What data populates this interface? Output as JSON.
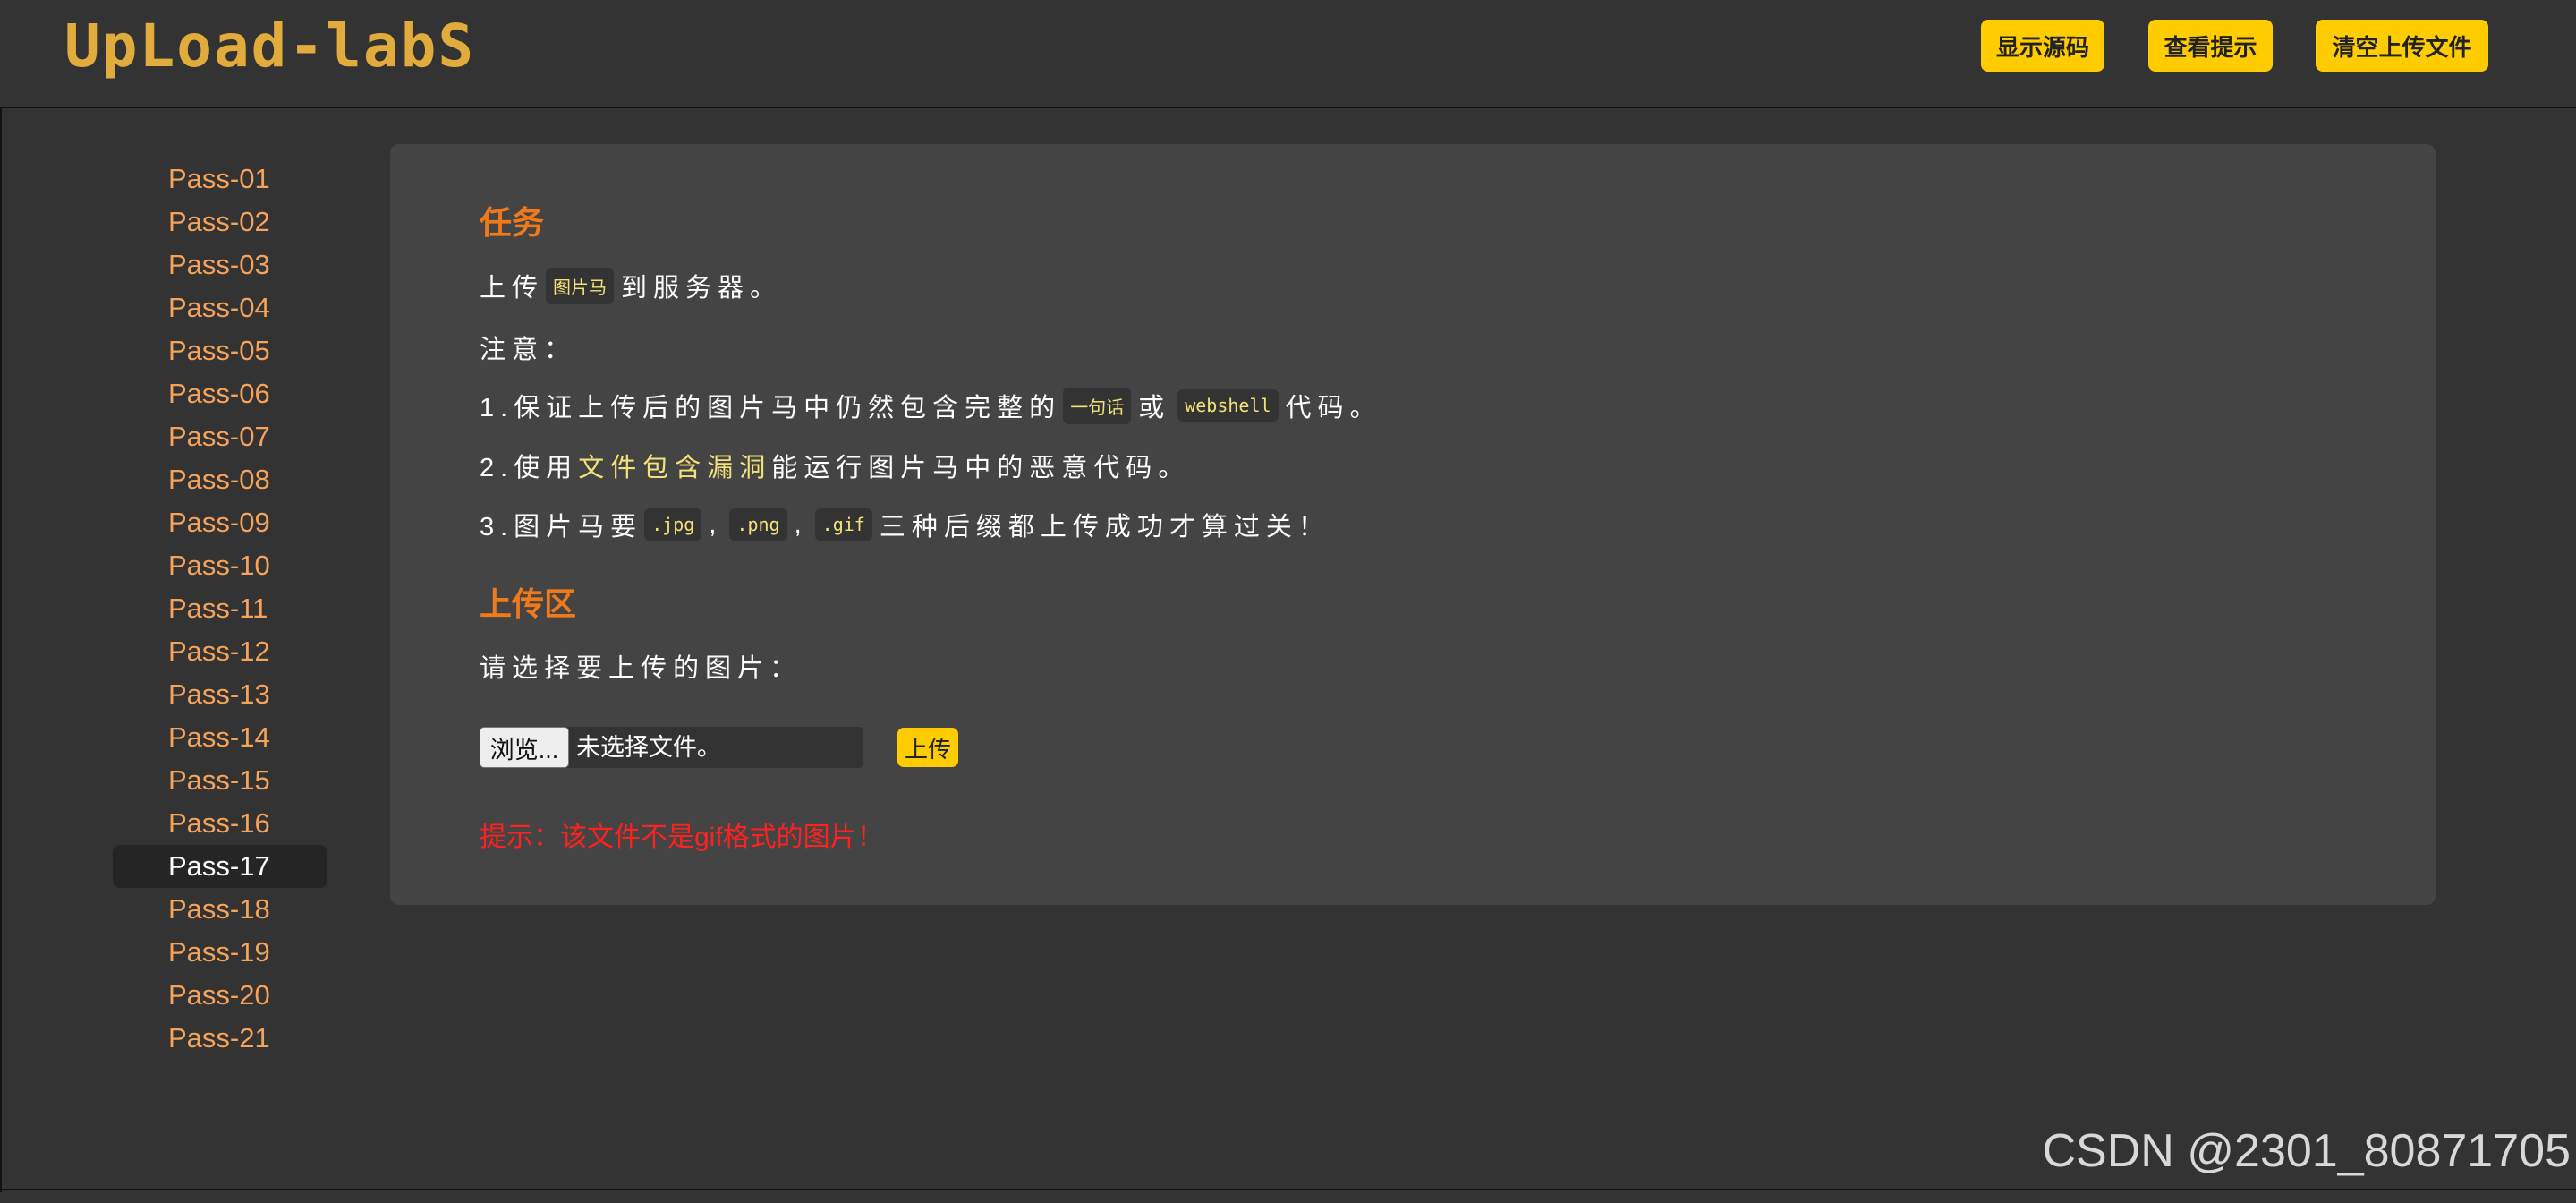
{
  "header": {
    "logo_text": "UpLoad-labS",
    "buttons": [
      "显示源码",
      "查看提示",
      "清空上传文件"
    ]
  },
  "sidebar": {
    "items": [
      "Pass-01",
      "Pass-02",
      "Pass-03",
      "Pass-04",
      "Pass-05",
      "Pass-06",
      "Pass-07",
      "Pass-08",
      "Pass-09",
      "Pass-10",
      "Pass-11",
      "Pass-12",
      "Pass-13",
      "Pass-14",
      "Pass-15",
      "Pass-16",
      "Pass-17",
      "Pass-18",
      "Pass-19",
      "Pass-20",
      "Pass-21"
    ],
    "active": "Pass-17"
  },
  "task": {
    "title": "任务",
    "line1_pre": "上传",
    "line1_code": "图片马",
    "line1_post": "到服务器。",
    "note": "注意：",
    "item1_pre": "1.保证上传后的图片马中仍然包含完整的",
    "item1_code1": "一句话",
    "item1_mid": "或",
    "item1_code2": "webshell",
    "item1_post": "代码。",
    "item2_pre": "2.使用",
    "item2_hl": "文件包含漏洞",
    "item2_post": "能运行图片马中的恶意代码。",
    "item3_pre": "3.图片马要",
    "item3_code1": ".jpg",
    "item3_sep1": ",",
    "item3_code2": ".png",
    "item3_sep2": ",",
    "item3_code3": ".gif",
    "item3_post": "三种后缀都上传成功才算过关！"
  },
  "upload": {
    "title": "上传区",
    "prompt": "请选择要上传的图片：",
    "browse_label": "浏览...",
    "no_file_label": "未选择文件。",
    "submit_label": "上传",
    "message": "提示：该文件不是gif格式的图片！"
  },
  "colors": {
    "accent": "#ffcc00",
    "title": "#f07a1a",
    "link": "#f5a35a",
    "error": "#ff2020",
    "code_text": "#f3e27a",
    "logo": "#e2ac3c"
  },
  "watermark": "CSDN @2301_80871705"
}
